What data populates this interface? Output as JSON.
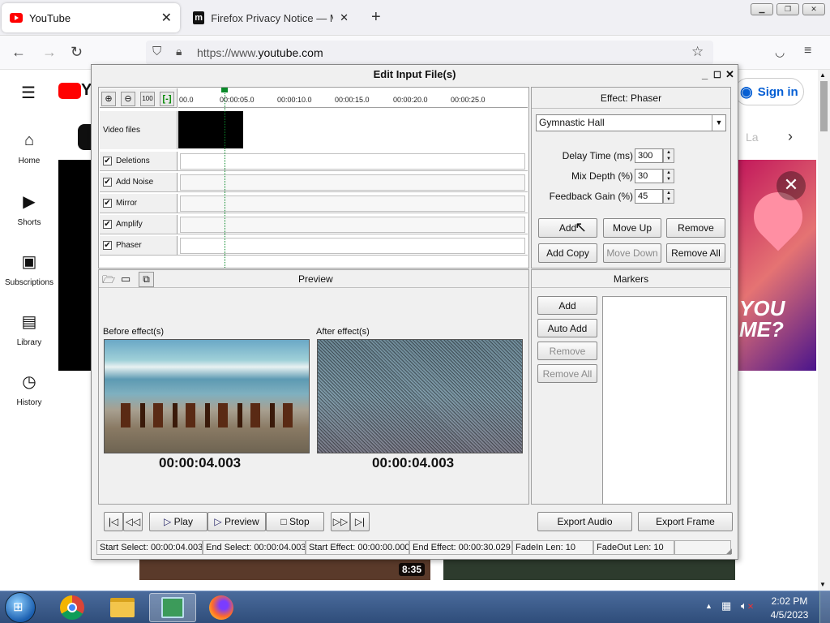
{
  "browser": {
    "tabs": [
      {
        "title": "YouTube",
        "active": true
      },
      {
        "title": "Firefox Privacy Notice — Mozilla",
        "active": false
      }
    ],
    "url_prefix": "https://www.",
    "url_domain": "youtube.com",
    "new_tab_glyph": "+",
    "close_glyph": "✕"
  },
  "youtube": {
    "logo_text": "Y",
    "sidebar": [
      {
        "label": "Home",
        "icon": "home-icon"
      },
      {
        "label": "Shorts",
        "icon": "shorts-icon"
      },
      {
        "label": "Subscriptions",
        "icon": "subscriptions-icon"
      },
      {
        "label": "Library",
        "icon": "library-icon"
      },
      {
        "label": "History",
        "icon": "history-icon"
      }
    ],
    "sign_in": "Sign in",
    "chip_partial": "La",
    "thumb_text": "YOU\nME?",
    "duration": "8:35"
  },
  "dialog": {
    "title": "Edit Input File(s)",
    "timeline_ticks": [
      "00.0",
      "00:00:05.0",
      "00:00:10.0",
      "00:00:15.0",
      "00:00:20.0",
      "00:00:25.0"
    ],
    "video_files_label": "Video files",
    "tracks": [
      {
        "label": "Deletions",
        "checked": true
      },
      {
        "label": "Add Noise",
        "checked": true
      },
      {
        "label": "Mirror",
        "checked": true
      },
      {
        "label": "Amplify",
        "checked": true
      },
      {
        "label": "Phaser",
        "checked": true
      }
    ],
    "effect": {
      "header": "Effect: Phaser",
      "preset": "Gymnastic Hall",
      "params": [
        {
          "label": "Delay Time (ms)",
          "value": "300"
        },
        {
          "label": "Mix Depth (%)",
          "value": "30"
        },
        {
          "label": "Feedback Gain (%)",
          "value": "45"
        }
      ],
      "buttons": {
        "add": "Add",
        "move_up": "Move Up",
        "remove": "Remove",
        "add_copy": "Add Copy",
        "move_down": "Move Down",
        "remove_all": "Remove All"
      }
    },
    "preview": {
      "header": "Preview",
      "before_label": "Before effect(s)",
      "after_label": "After effect(s)",
      "before_time": "00:00:04.003",
      "after_time": "00:00:04.003"
    },
    "markers": {
      "header": "Markers",
      "add": "Add",
      "auto_add": "Auto Add",
      "remove": "Remove",
      "remove_all": "Remove All"
    },
    "transport": {
      "play": "Play",
      "preview": "Preview",
      "stop": "Stop",
      "export_audio": "Export Audio",
      "export_frame": "Export Frame"
    },
    "status": [
      "Start Select: 00:00:04.003",
      "End Select: 00:00:04.003",
      "Start Effect: 00:00:00.000",
      "End Effect: 00:00:30.029",
      "FadeIn Len: 10",
      "FadeOut Len: 10"
    ]
  },
  "taskbar": {
    "time": "2:02 PM",
    "date": "4/5/2023"
  }
}
